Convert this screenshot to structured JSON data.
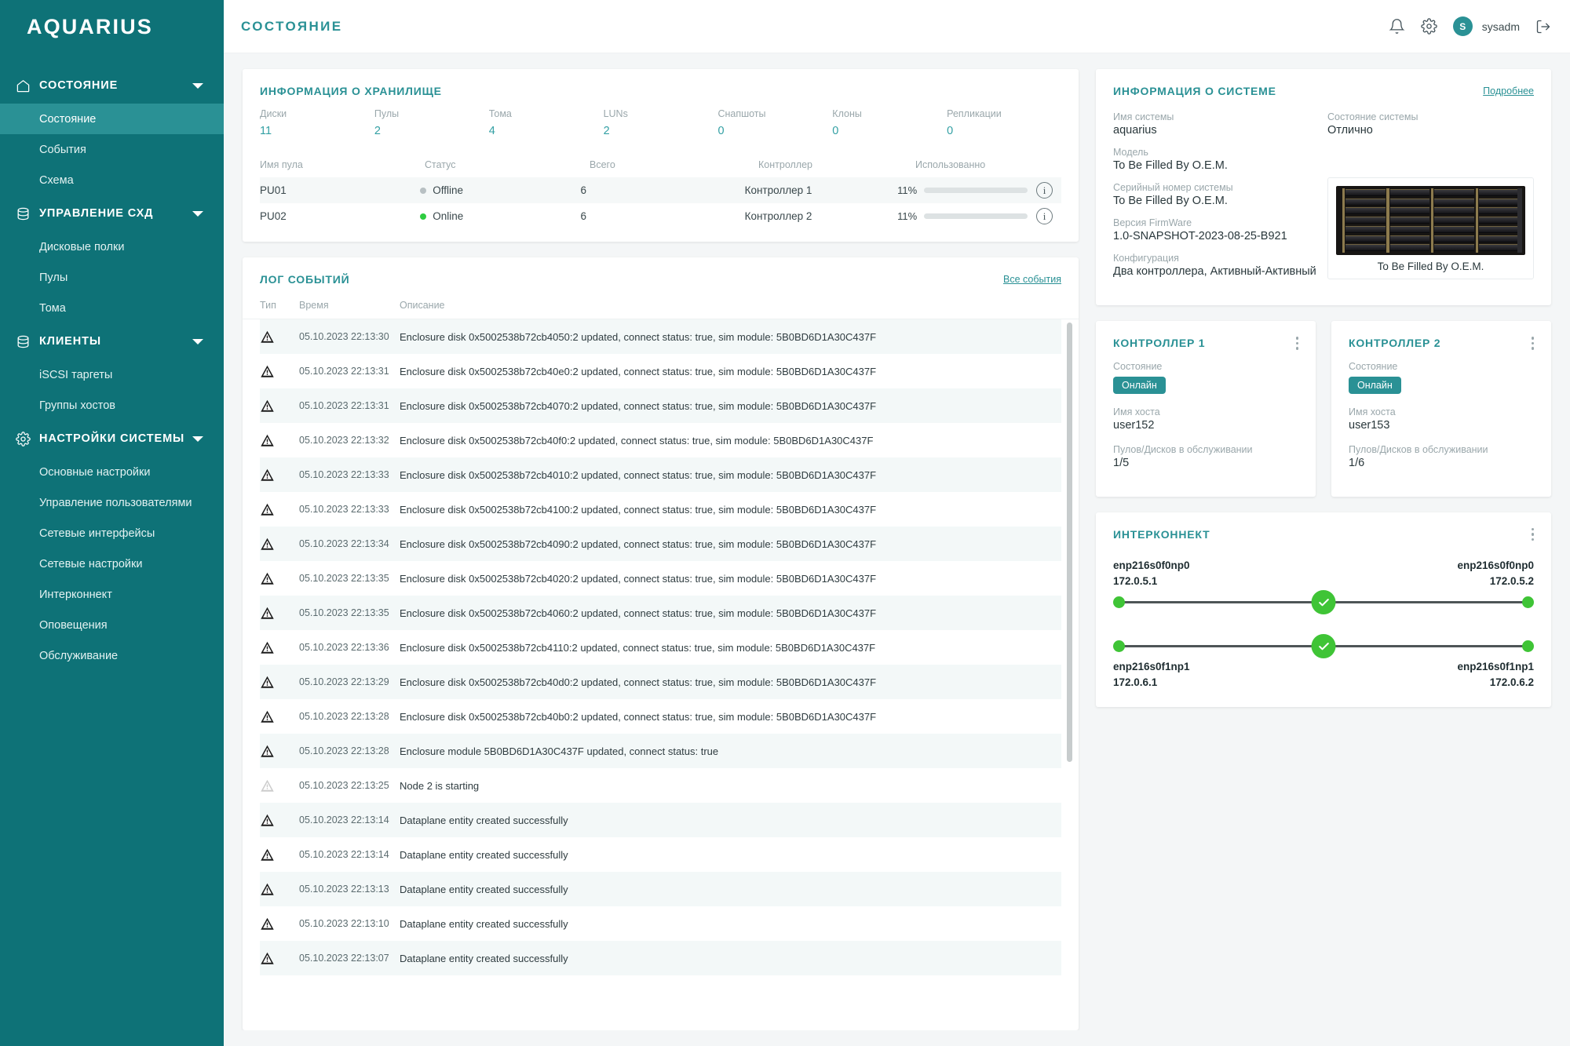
{
  "brand": {
    "name": "AQUARIUS"
  },
  "header": {
    "title": "СОСТОЯНИЕ",
    "bell_icon": "bell-icon",
    "gear_icon": "gear-icon",
    "avatar_initial": "S",
    "username": "sysadm",
    "logout_icon": "logout-icon"
  },
  "sidebar": {
    "groups": [
      {
        "label": "СОСТОЯНИЕ",
        "icon": "home-icon",
        "items": [
          {
            "label": "Состояние",
            "active": true
          },
          {
            "label": "События",
            "active": false
          },
          {
            "label": "Схема",
            "active": false
          }
        ]
      },
      {
        "label": "УПРАВЛЕНИЕ СХД",
        "icon": "database-icon",
        "items": [
          {
            "label": "Дисковые полки",
            "active": false
          },
          {
            "label": "Пулы",
            "active": false
          },
          {
            "label": "Тома",
            "active": false
          }
        ]
      },
      {
        "label": "КЛИЕНТЫ",
        "icon": "database-icon",
        "items": [
          {
            "label": "iSCSI таргеты",
            "active": false
          },
          {
            "label": "Группы хостов",
            "active": false
          }
        ]
      },
      {
        "label": "НАСТРОЙКИ СИСТЕМЫ",
        "icon": "gear-icon",
        "items": [
          {
            "label": "Основные настройки",
            "active": false
          },
          {
            "label": "Управление пользователями",
            "active": false
          },
          {
            "label": "Сетевые интерфейсы",
            "active": false
          },
          {
            "label": "Сетевые настройки",
            "active": false
          },
          {
            "label": "Интерконнект",
            "active": false
          },
          {
            "label": "Оповещения",
            "active": false
          },
          {
            "label": "Обслуживание",
            "active": false
          }
        ]
      }
    ]
  },
  "storage_info": {
    "title": "ИНФОРМАЦИЯ О ХРАНИЛИЩЕ",
    "stats": [
      {
        "label": "Диски",
        "value": "11"
      },
      {
        "label": "Пулы",
        "value": "2"
      },
      {
        "label": "Тома",
        "value": "4"
      },
      {
        "label": "LUNs",
        "value": "2"
      },
      {
        "label": "Снапшоты",
        "value": "0"
      },
      {
        "label": "Клоны",
        "value": "0"
      },
      {
        "label": "Репликации",
        "value": "0"
      }
    ],
    "columns": [
      "Имя пула",
      "Статус",
      "Всего",
      "Контроллер",
      "Использованно"
    ],
    "rows": [
      {
        "name": "PU01",
        "status": "Offline",
        "status_state": "offline",
        "total": "6",
        "controller": "Контроллер 1",
        "used_pct": "11%",
        "used_value": 11
      },
      {
        "name": "PU02",
        "status": "Online",
        "status_state": "online",
        "total": "6",
        "controller": "Контроллер 2",
        "used_pct": "11%",
        "used_value": 11
      }
    ],
    "info_icon": "info-icon"
  },
  "event_log": {
    "title": "ЛОГ СОБЫТИЙ",
    "all_events_link": "Все события",
    "columns": [
      "Тип",
      "Время",
      "Описание"
    ],
    "rows": [
      {
        "severity": "warning",
        "time": "05.10.2023 22:13:30",
        "description": "Enclosure disk 0x5002538b72cb4050:2 updated, connect status: true, sim module: 5B0BD6D1A30C437F"
      },
      {
        "severity": "warning",
        "time": "05.10.2023 22:13:31",
        "description": "Enclosure disk 0x5002538b72cb40e0:2 updated, connect status: true, sim module: 5B0BD6D1A30C437F"
      },
      {
        "severity": "warning",
        "time": "05.10.2023 22:13:31",
        "description": "Enclosure disk 0x5002538b72cb4070:2 updated, connect status: true, sim module: 5B0BD6D1A30C437F"
      },
      {
        "severity": "warning",
        "time": "05.10.2023 22:13:32",
        "description": "Enclosure disk 0x5002538b72cb40f0:2 updated, connect status: true, sim module: 5B0BD6D1A30C437F"
      },
      {
        "severity": "warning",
        "time": "05.10.2023 22:13:33",
        "description": "Enclosure disk 0x5002538b72cb4010:2 updated, connect status: true, sim module: 5B0BD6D1A30C437F"
      },
      {
        "severity": "warning",
        "time": "05.10.2023 22:13:33",
        "description": "Enclosure disk 0x5002538b72cb4100:2 updated, connect status: true, sim module: 5B0BD6D1A30C437F"
      },
      {
        "severity": "warning",
        "time": "05.10.2023 22:13:34",
        "description": "Enclosure disk 0x5002538b72cb4090:2 updated, connect status: true, sim module: 5B0BD6D1A30C437F"
      },
      {
        "severity": "warning",
        "time": "05.10.2023 22:13:35",
        "description": "Enclosure disk 0x5002538b72cb4020:2 updated, connect status: true, sim module: 5B0BD6D1A30C437F"
      },
      {
        "severity": "warning",
        "time": "05.10.2023 22:13:35",
        "description": "Enclosure disk 0x5002538b72cb4060:2 updated, connect status: true, sim module: 5B0BD6D1A30C437F"
      },
      {
        "severity": "warning",
        "time": "05.10.2023 22:13:36",
        "description": "Enclosure disk 0x5002538b72cb4110:2 updated, connect status: true, sim module: 5B0BD6D1A30C437F"
      },
      {
        "severity": "warning",
        "time": "05.10.2023 22:13:29",
        "description": "Enclosure disk 0x5002538b72cb40d0:2 updated, connect status: true, sim module: 5B0BD6D1A30C437F"
      },
      {
        "severity": "warning",
        "time": "05.10.2023 22:13:28",
        "description": "Enclosure disk 0x5002538b72cb40b0:2 updated, connect status: true, sim module: 5B0BD6D1A30C437F"
      },
      {
        "severity": "warning",
        "time": "05.10.2023 22:13:28",
        "description": "Enclosure module 5B0BD6D1A30C437F updated, connect status: true"
      },
      {
        "severity": "info",
        "time": "05.10.2023 22:13:25",
        "description": "Node 2 is starting"
      },
      {
        "severity": "warning",
        "time": "05.10.2023 22:13:14",
        "description": "Dataplane entity created successfully"
      },
      {
        "severity": "warning",
        "time": "05.10.2023 22:13:14",
        "description": "Dataplane entity created successfully"
      },
      {
        "severity": "warning",
        "time": "05.10.2023 22:13:13",
        "description": "Dataplane entity created successfully"
      },
      {
        "severity": "warning",
        "time": "05.10.2023 22:13:10",
        "description": "Dataplane entity created successfully"
      },
      {
        "severity": "warning",
        "time": "05.10.2023 22:13:07",
        "description": "Dataplane entity created successfully"
      }
    ]
  },
  "system_info": {
    "title": "ИНФОРМАЦИЯ О СИСТЕМЕ",
    "details_link": "Подробнее",
    "fields_left": [
      {
        "label": "Имя системы",
        "value": "aquarius"
      },
      {
        "label": "Модель",
        "value": "To Be Filled By O.E.M."
      },
      {
        "label": "Серийный номер системы",
        "value": "To Be Filled By O.E.M."
      },
      {
        "label": "Версия FirmWare",
        "value": "1.0-SNAPSHOT-2023-08-25-B921"
      },
      {
        "label": "Конфигурация",
        "value": "Два контроллера, Активный-Активный"
      }
    ],
    "fields_right": [
      {
        "label": "Состояние системы",
        "value": "Отлично"
      }
    ],
    "device_caption": "To Be Filled By O.E.M."
  },
  "controllers": [
    {
      "title": "КОНТРОЛЛЕР 1",
      "state_label": "Состояние",
      "state_value": "Онлайн",
      "hostname_label": "Имя хоста",
      "hostname_value": "user152",
      "pools_label": "Пулов/Дисков в обслуживании",
      "pools_value": "1/5",
      "menu_icon": "kebab-menu-icon"
    },
    {
      "title": "КОНТРОЛЛЕР 2",
      "state_label": "Состояние",
      "state_value": "Онлайн",
      "hostname_label": "Имя хоста",
      "hostname_value": "user153",
      "pools_label": "Пулов/Дисков в обслуживании",
      "pools_value": "1/6",
      "menu_icon": "kebab-menu-icon"
    }
  ],
  "interconnect": {
    "title": "ИНТЕРКОННЕКТ",
    "menu_icon": "kebab-menu-icon",
    "links": [
      {
        "labels_on_top": true,
        "left_iface": "enp216s0f0np0",
        "left_ip": "172.0.5.1",
        "right_iface": "enp216s0f0np0",
        "right_ip": "172.0.5.2",
        "status": "ok"
      },
      {
        "labels_on_top": false,
        "left_iface": "enp216s0f1np1",
        "left_ip": "172.0.6.1",
        "right_iface": "enp216s0f1np1",
        "right_ip": "172.0.6.2",
        "status": "ok"
      }
    ]
  },
  "colors": {
    "sidebar": "#0e7277",
    "sidebar_active": "#2a9195",
    "accent": "#2a9195",
    "stat_value": "#33a0a4",
    "online": "#2ecc40",
    "offline": "#b8c0c3",
    "link_ok": "#3fc436",
    "bar_fill": "#33b0a8"
  }
}
